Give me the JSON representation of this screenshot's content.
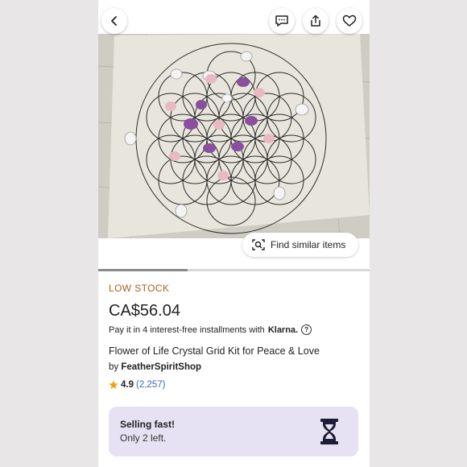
{
  "colors": {
    "accent_low_stock": "#a8611a",
    "selling_box_bg": "#e6e2f3",
    "rating_link": "#3b66b0",
    "star": "#f1a10d"
  },
  "header": {
    "icons": [
      "chevron-left-icon",
      "message-icon",
      "share-icon",
      "heart-icon"
    ]
  },
  "gallery": {
    "find_similar_label": "Find similar items",
    "image_progress": 0.33
  },
  "product": {
    "stock_badge": "LOW STOCK",
    "price": "CA$56.04",
    "klarna_text": "Pay it in 4 interest-free installments with",
    "klarna_brand": "Klarna.",
    "klarna_help": "?",
    "title": "Flower of Life Crystal Grid Kit for Peace & Love",
    "by_prefix": "by",
    "shop_name": "FeatherSpiritShop",
    "rating": "4.9",
    "review_count": "(2,257)"
  },
  "notice": {
    "title": "Selling fast!",
    "subtitle": "Only 2 left."
  }
}
